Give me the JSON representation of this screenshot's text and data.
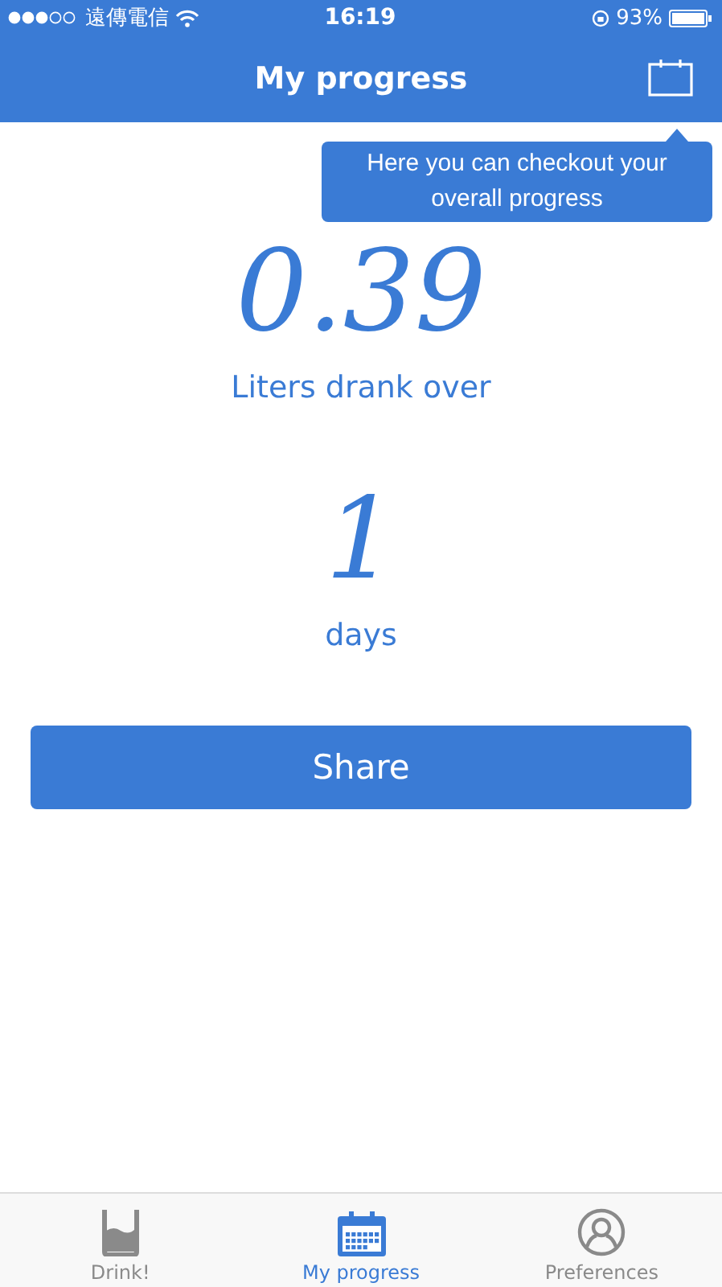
{
  "status_bar": {
    "carrier": "遠傳電信",
    "time": "16:19",
    "battery": "93%"
  },
  "nav": {
    "title": "My progress"
  },
  "tooltip": {
    "text": "Here you can checkout your overall progress"
  },
  "stats": {
    "amount": "0.39",
    "amount_label": "Liters drank over",
    "days": "1",
    "days_label": "days"
  },
  "share_button": "Share",
  "tabs": [
    {
      "label": "Drink!",
      "kind": "glass",
      "selected": false
    },
    {
      "label": "My progress",
      "kind": "calendar",
      "selected": true
    },
    {
      "label": "Preferences",
      "kind": "person",
      "selected": false
    }
  ]
}
